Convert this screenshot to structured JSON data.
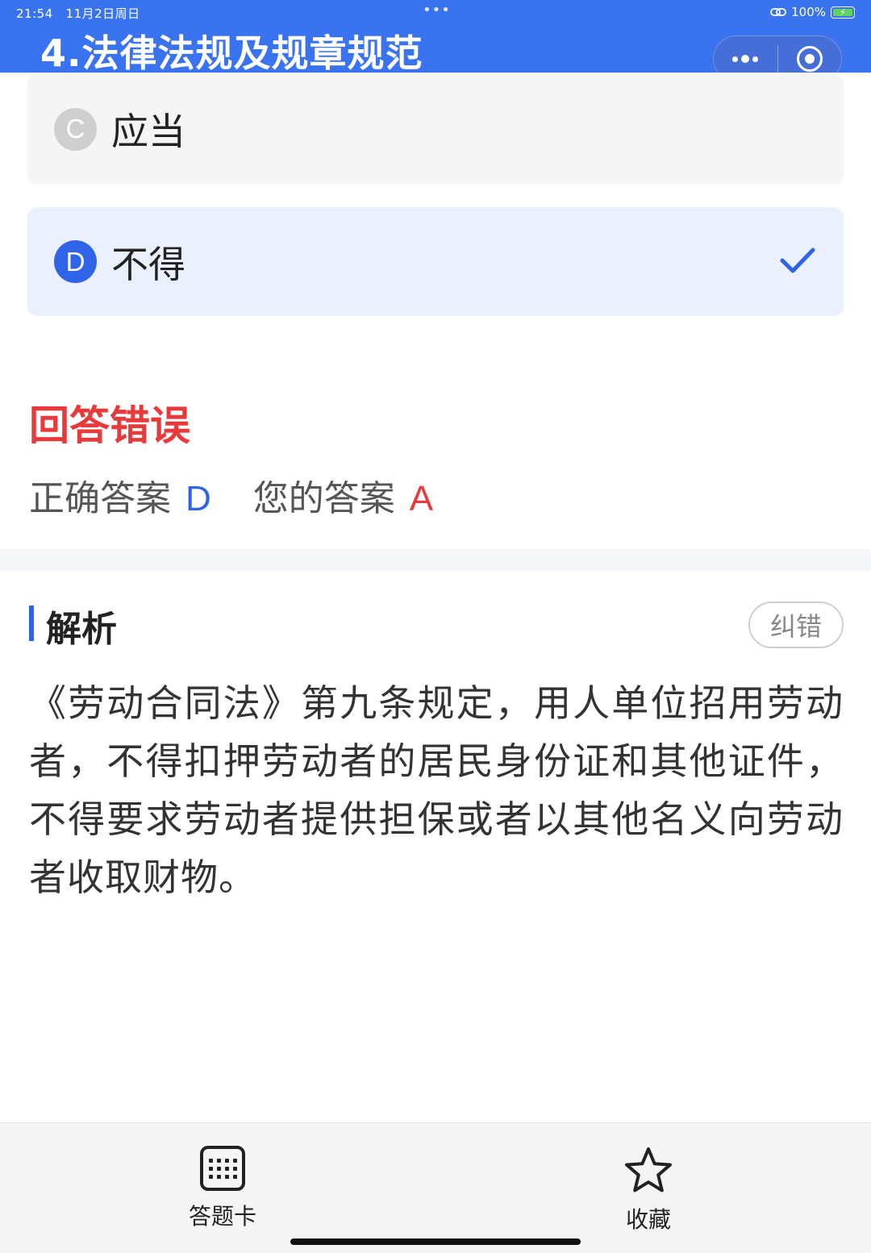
{
  "status_bar": {
    "time": "21:54",
    "date": "11月2日周日",
    "dots": "•••",
    "battery": "100%"
  },
  "header": {
    "title": "4.法律法规及规章规范"
  },
  "options": [
    {
      "letter": "C",
      "text": "应当",
      "selected": false
    },
    {
      "letter": "D",
      "text": "不得",
      "selected": true
    }
  ],
  "result": {
    "title": "回答错误",
    "correct_label": "正确答案",
    "correct_answer": "D",
    "user_label": "您的答案",
    "user_answer": "A"
  },
  "analysis": {
    "title": "解析",
    "report_button": "纠错",
    "text": "《劳动合同法》第九条规定，用人单位招用劳动者，不得扣押劳动者的居民身份证和其他证件，不得要求劳动者提供担保或者以其他名义向劳动者收取财物。"
  },
  "bottom_bar": {
    "answer_card_label": "答题卡",
    "favorite_label": "收藏"
  },
  "colors": {
    "header_blue": "#3a73f0",
    "accent_blue": "#2f63e8",
    "error_red": "#e83a3a",
    "selected_bg": "#eaf0fd"
  }
}
